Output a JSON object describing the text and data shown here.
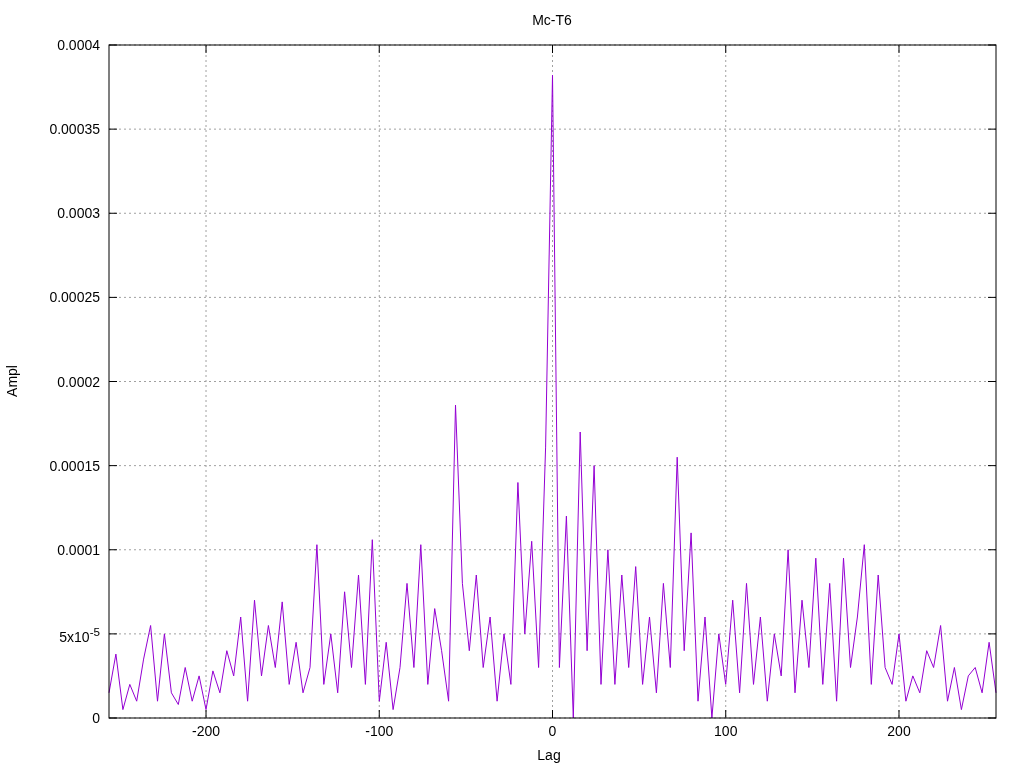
{
  "chart_data": {
    "type": "line",
    "grid": true,
    "title": "Mc-T6",
    "xlabel": "Lag",
    "ylabel": "Ampl",
    "xlim": [
      -256,
      256
    ],
    "ylim": [
      0,
      0.0004
    ],
    "xticks": [
      -200,
      -100,
      0,
      100,
      200
    ],
    "yticks": [
      0,
      {
        "value": 5e-05,
        "label": "5x10$^{-5}$"
      },
      0.0001,
      0.00015,
      0.0002,
      0.00025,
      0.0003,
      0.00035,
      0.0004
    ],
    "x": [
      -256,
      -252,
      -248,
      -244,
      -240,
      -236,
      -232,
      -228,
      -224,
      -220,
      -216,
      -212,
      -208,
      -204,
      -200,
      -196,
      -192,
      -188,
      -184,
      -180,
      -176,
      -172,
      -168,
      -164,
      -160,
      -156,
      -152,
      -148,
      -144,
      -140,
      -136,
      -132,
      -128,
      -124,
      -120,
      -116,
      -112,
      -108,
      -104,
      -100,
      -96,
      -92,
      -88,
      -84,
      -80,
      -76,
      -72,
      -68,
      -64,
      -60,
      -56,
      -52,
      -48,
      -44,
      -40,
      -36,
      -32,
      -28,
      -24,
      -20,
      -16,
      -12,
      -8,
      -4,
      0,
      4,
      8,
      12,
      16,
      20,
      24,
      28,
      32,
      36,
      40,
      44,
      48,
      52,
      56,
      60,
      64,
      68,
      72,
      76,
      80,
      84,
      88,
      92,
      96,
      100,
      104,
      108,
      112,
      116,
      120,
      124,
      128,
      132,
      136,
      140,
      144,
      148,
      152,
      156,
      160,
      164,
      168,
      172,
      176,
      180,
      184,
      188,
      192,
      196,
      200,
      204,
      208,
      212,
      216,
      220,
      224,
      228,
      232,
      236,
      240,
      244,
      248,
      252,
      256
    ],
    "series": [
      {
        "color": "#9400d3",
        "values": [
          1.5e-05,
          3.8e-05,
          5e-06,
          2e-05,
          1e-05,
          3.5e-05,
          5.5e-05,
          1e-05,
          5e-05,
          1.5e-05,
          8e-06,
          3e-05,
          1e-05,
          2.5e-05,
          5e-06,
          2.8e-05,
          1.5e-05,
          4e-05,
          2.5e-05,
          6e-05,
          1e-05,
          7e-05,
          2.5e-05,
          5.5e-05,
          3e-05,
          6.9e-05,
          2e-05,
          4.5e-05,
          1.5e-05,
          3e-05,
          0.000103,
          2e-05,
          5e-05,
          1.5e-05,
          7.5e-05,
          3e-05,
          8.5e-05,
          2e-05,
          0.000106,
          1e-05,
          4.5e-05,
          5e-06,
          3e-05,
          8e-05,
          3e-05,
          0.000103,
          2e-05,
          6.5e-05,
          4e-05,
          1e-05,
          0.000186,
          8e-05,
          4e-05,
          8.5e-05,
          3e-05,
          6e-05,
          1e-05,
          5e-05,
          2e-05,
          0.00014,
          5e-05,
          0.000105,
          3e-05,
          0.000161,
          0.000382,
          3e-05,
          0.00012,
          0,
          0.00017,
          4e-05,
          0.00015,
          2e-05,
          0.0001,
          2e-05,
          8.5e-05,
          3e-05,
          9e-05,
          2e-05,
          6e-05,
          1.5e-05,
          8e-05,
          3e-05,
          0.000155,
          4e-05,
          0.00011,
          1e-05,
          6e-05,
          0,
          5e-05,
          2e-05,
          7e-05,
          1.5e-05,
          8e-05,
          2e-05,
          6e-05,
          1e-05,
          5e-05,
          2.5e-05,
          0.0001,
          1.5e-05,
          7e-05,
          3e-05,
          9.5e-05,
          2e-05,
          8e-05,
          1e-05,
          9.5e-05,
          3e-05,
          6e-05,
          0.000103,
          2e-05,
          8.5e-05,
          3e-05,
          2e-05,
          5e-05,
          1e-05,
          2.5e-05,
          1.5e-05,
          4e-05,
          3e-05,
          5.5e-05,
          1e-05,
          3e-05,
          5e-06,
          2.5e-05,
          3e-05,
          1.5e-05,
          4.5e-05,
          1.5e-05
        ]
      }
    ]
  }
}
